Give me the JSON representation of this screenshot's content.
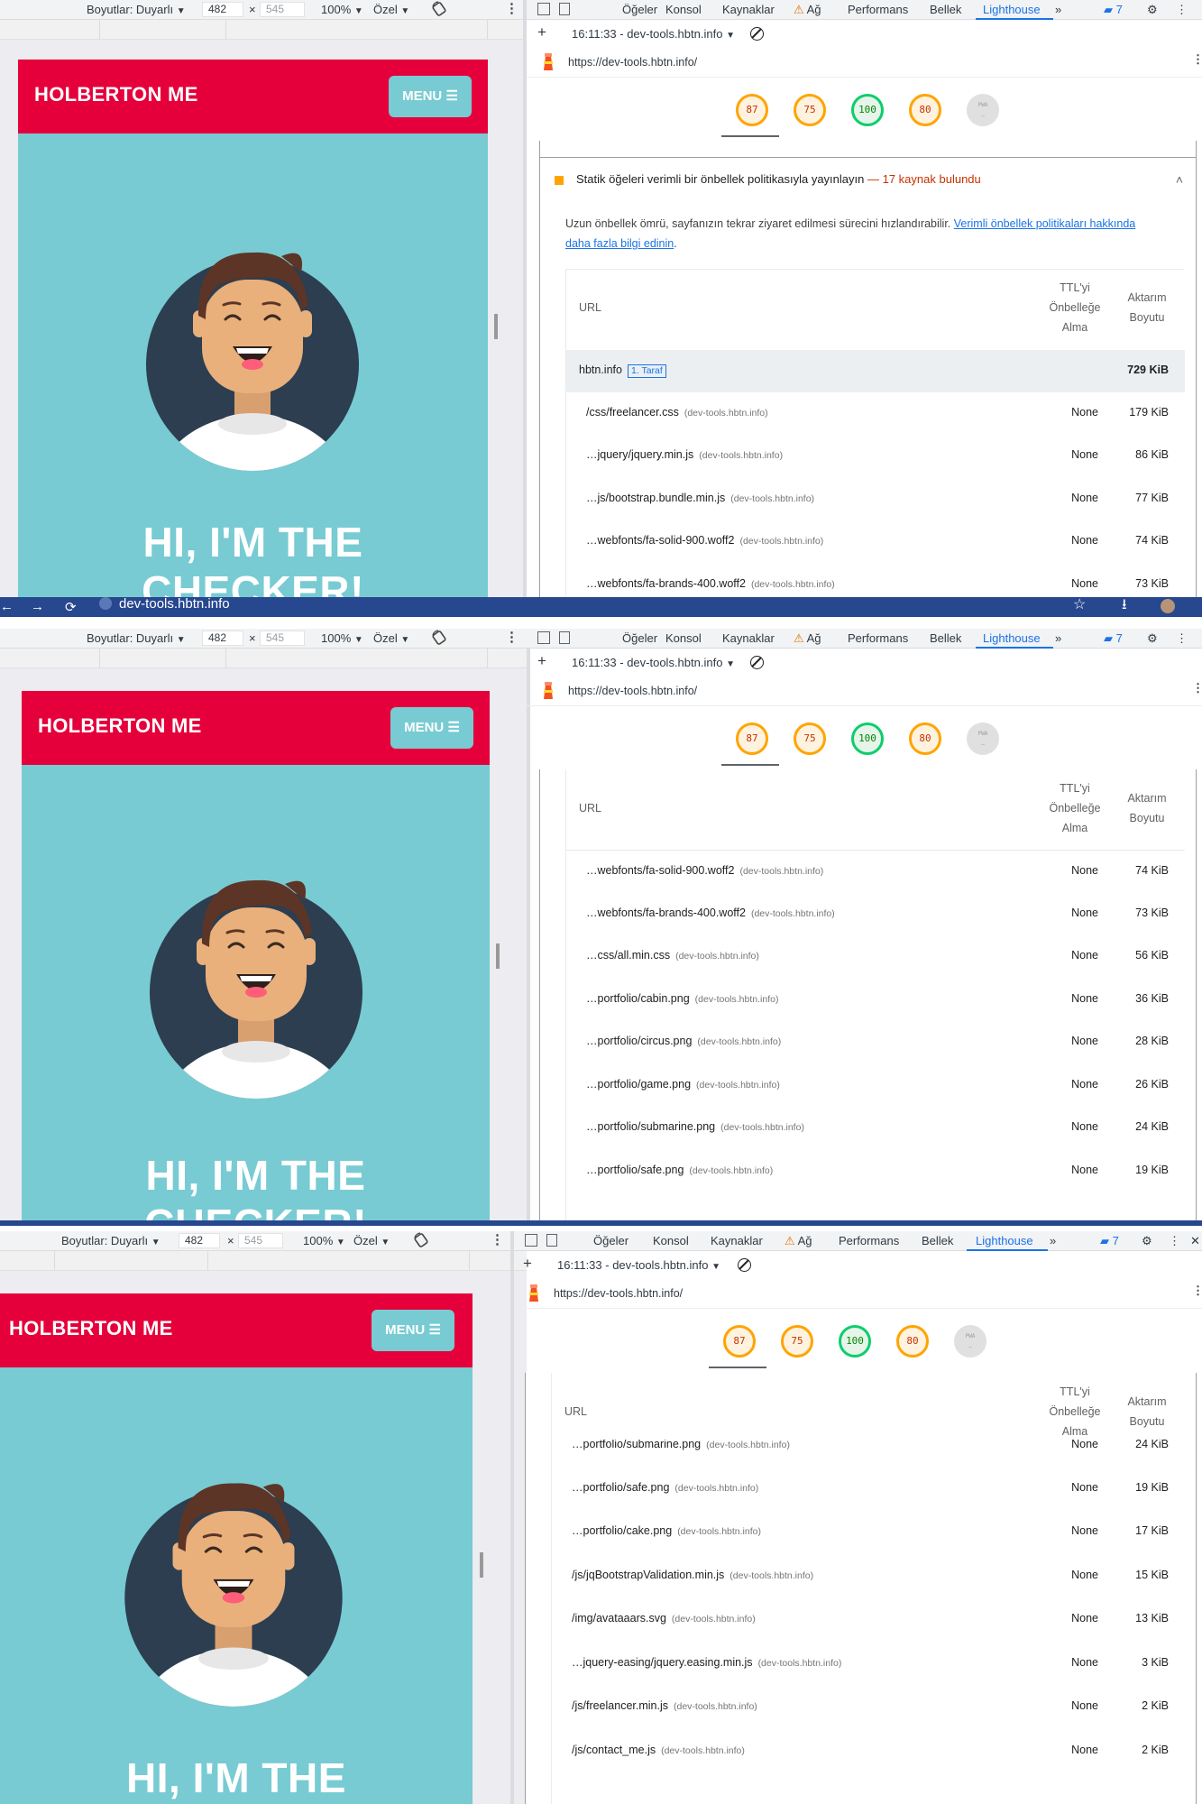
{
  "browser": {
    "back": "←",
    "forward": "→",
    "reload": "⟳",
    "address": "dev-tools.hbtn.info",
    "bookmark": "☆",
    "download": "⭳"
  },
  "device_toolbar": {
    "dimensions_label": "Boyutlar: Duyarlı",
    "width": "482",
    "times": "×",
    "height": "545",
    "zoom": "100%",
    "throttle": "Özel",
    "caret": "▼",
    "more": "⋮"
  },
  "site": {
    "brand": "HOLBERTON ME",
    "menu_label": "MENU",
    "menu_glyph": "☰",
    "hero_line1": "HI, I'M THE",
    "hero_line2": "CHECKER!"
  },
  "devtools": {
    "tabs": [
      "Öğeler",
      "Konsol",
      "Kaynaklar",
      "Ağ",
      "Performans",
      "Bellek",
      "Lighthouse"
    ],
    "active_tab": "Lighthouse",
    "overflow": "»",
    "warn_glyph": "⚠",
    "issues_glyph": "▰",
    "issues_count": "7",
    "settings_glyph": "⚙",
    "more": "⋮",
    "close": "✕",
    "plus": "+",
    "report_time": "16:11:33 - dev-tools.hbtn.info",
    "caret": "▼",
    "url": "https://dev-tools.hbtn.info/",
    "scores": [
      {
        "value": "87",
        "kind": "avg"
      },
      {
        "value": "75",
        "kind": "avg"
      },
      {
        "value": "100",
        "kind": "good"
      },
      {
        "value": "80",
        "kind": "avg"
      },
      {
        "value": "PWA",
        "kind": "na",
        "sub": "—"
      }
    ]
  },
  "audit": {
    "title": "Statik öğeleri verimli bir önbellek politikasıyla yayınlayın",
    "displayValue": "— 17 kaynak bulundu",
    "chevron": "˄",
    "description": "Uzun önbellek ömrü, sayfanızın tekrar ziyaret edilmesi sürecini hızlandırabilir.",
    "link_text": "Verimli önbellek politikaları hakkında daha fazla bilgi edinin",
    "description_end": "."
  },
  "table": {
    "col_url": "URL",
    "col_ttl": [
      "TTL'yi",
      "Önbelleğe",
      "Alma"
    ],
    "col_size": [
      "Aktarım",
      "Boyutu"
    ],
    "group": {
      "name": "hbtn.info",
      "tag": "1. Taraf",
      "size": "729 KiB"
    },
    "host": "(dev-tools.hbtn.info)",
    "rows": [
      {
        "url": "/css/freelancer.css",
        "ttl": "None",
        "size": "179 KiB"
      },
      {
        "url": "…jquery/jquery.min.js",
        "ttl": "None",
        "size": "86 KiB"
      },
      {
        "url": "…js/bootstrap.bundle.min.js",
        "ttl": "None",
        "size": "77 KiB"
      },
      {
        "url": "…webfonts/fa-solid-900.woff2",
        "ttl": "None",
        "size": "74 KiB"
      },
      {
        "url": "…webfonts/fa-brands-400.woff2",
        "ttl": "None",
        "size": "73 KiB"
      },
      {
        "url": "…css/all.min.css",
        "ttl": "None",
        "size": "56 KiB"
      },
      {
        "url": "…portfolio/cabin.png",
        "ttl": "None",
        "size": "36 KiB"
      },
      {
        "url": "…portfolio/circus.png",
        "ttl": "None",
        "size": "28 KiB"
      },
      {
        "url": "…portfolio/game.png",
        "ttl": "None",
        "size": "26 KiB"
      },
      {
        "url": "…portfolio/submarine.png",
        "ttl": "None",
        "size": "24 KiB"
      },
      {
        "url": "…portfolio/safe.png",
        "ttl": "None",
        "size": "19 KiB"
      },
      {
        "url": "…portfolio/cake.png",
        "ttl": "None",
        "size": "17 KiB"
      },
      {
        "url": "/js/jqBootstrapValidation.min.js",
        "ttl": "None",
        "size": "15 KiB"
      },
      {
        "url": "/img/avataaars.svg",
        "ttl": "None",
        "size": "13 KiB"
      },
      {
        "url": "…jquery-easing/jquery.easing.min.js",
        "ttl": "None",
        "size": "3 KiB"
      },
      {
        "url": "/js/freelancer.min.js",
        "ttl": "None",
        "size": "2 KiB"
      },
      {
        "url": "/js/contact_me.js",
        "ttl": "None",
        "size": "2 KiB"
      }
    ]
  },
  "colors": {
    "nav_red": "#e5003b",
    "site_teal": "#78cbd2",
    "avatar_navy": "#2c3e50",
    "chrome_blue": "#27478f",
    "devtools_accent": "#1a73e8"
  }
}
